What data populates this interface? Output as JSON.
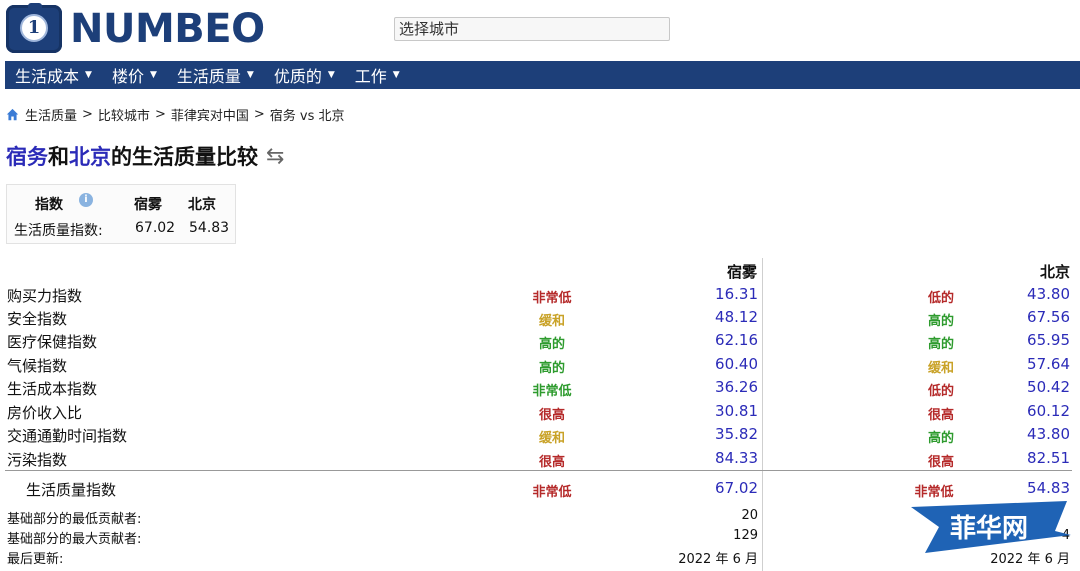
{
  "header": {
    "logo_text": "NUMBEO",
    "search_placeholder": "选择城市"
  },
  "nav": [
    {
      "label": "生活成本"
    },
    {
      "label": "楼价"
    },
    {
      "label": "生活质量"
    },
    {
      "label": "优质的"
    },
    {
      "label": "工作"
    }
  ],
  "breadcrumb": [
    "生活质量",
    "比较城市",
    "菲律宾对中国",
    "宿务 vs 北京"
  ],
  "title": {
    "city1": "宿务",
    "and": "和",
    "city2": "北京",
    "suffix": "的生活质量比较"
  },
  "summary": {
    "col_index": "指数",
    "col_city1": "宿雾",
    "col_city2": "北京",
    "row_label": "生活质量指数:",
    "val_city1": "67.02",
    "val_city2": "54.83"
  },
  "table": {
    "city1_header": "宿雾",
    "city2_header": "北京",
    "rows": [
      {
        "label": "购买力指数",
        "lvl1": "非常低",
        "val1": "16.31",
        "lvl2": "低的",
        "val2": "43.80"
      },
      {
        "label": "安全指数",
        "lvl1": "缓和",
        "val1": "48.12",
        "lvl2": "高的",
        "val2": "67.56"
      },
      {
        "label": "医疗保健指数",
        "lvl1": "高的",
        "val1": "62.16",
        "lvl2": "高的",
        "val2": "65.95"
      },
      {
        "label": "气候指数",
        "lvl1": "高的",
        "val1": "60.40",
        "lvl2": "缓和",
        "val2": "57.64"
      },
      {
        "label": "生活成本指数",
        "lvl1": "非常低",
        "val1": "36.26",
        "lvl2": "低的",
        "val2": "50.42"
      },
      {
        "label": "房价收入比",
        "lvl1": "很高",
        "val1": "30.81",
        "lvl2": "很高",
        "val2": "60.12"
      },
      {
        "label": "交通通勤时间指数",
        "lvl1": "缓和",
        "val1": "35.82",
        "lvl2": "高的",
        "val2": "43.80"
      },
      {
        "label": "污染指数",
        "lvl1": "很高",
        "val1": "84.33",
        "lvl2": "很高",
        "val2": "82.51"
      }
    ],
    "total": {
      "label": "生活质量指数",
      "lvl1": "非常低",
      "val1": "67.02",
      "lvl2": "非常低",
      "val2": "54.83"
    },
    "footer": [
      {
        "label": "基础部分的最低贡献者:",
        "val1": "20",
        "val2": ""
      },
      {
        "label": "基础部分的最大贡献者:",
        "val1": "129",
        "val2": "4"
      },
      {
        "label": "最后更新:",
        "val1": "2022 年 6 月",
        "val2": "2022 年 6 月"
      }
    ]
  },
  "level_colors": {
    "非常低": "#b52a2a",
    "低的": "#b52a2a",
    "缓和": "#c9a227",
    "高的": "#2e9b2e",
    "很高": "#b52a2a"
  },
  "level_colors_col2": {
    "低的": "#b52a2a",
    "高的": "#2e9b2e",
    "缓和": "#c9a227",
    "很高": "#b52a2a",
    "非常低": "#b52a2a"
  },
  "level_colors_col1_override": {
    "生活成本指数": "#2e9b2e"
  },
  "watermark": {
    "text": "菲华网",
    "color": "#1f63b5"
  },
  "colors": {
    "brand": "#1d3f79",
    "link": "#2b2bb8"
  }
}
